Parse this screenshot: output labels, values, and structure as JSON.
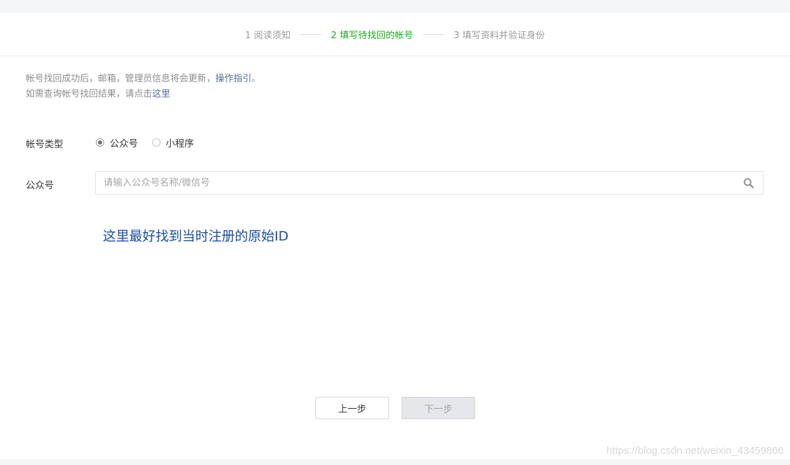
{
  "steps": [
    {
      "label": "1 阅读须知",
      "active": false
    },
    {
      "label": "2 填写待找回的帐号",
      "active": true
    },
    {
      "label": "3 填写资料并验证身份",
      "active": false
    }
  ],
  "notice": {
    "line1_text": "帐号找回成功后，邮箱，管理员信息将会更新，",
    "line1_link": "操作指引",
    "line1_end": "。",
    "line2_text": "如需查询帐号找回结果，请点击",
    "line2_link": "这里"
  },
  "account_type": {
    "label": "帐号类型",
    "options": [
      "公众号",
      "小程序"
    ],
    "selected": "公众号"
  },
  "official_account": {
    "label": "公众号",
    "placeholder": "请输入公众号名称/微信号",
    "value": ""
  },
  "annotation_text": "这里最好找到当时注册的原始ID",
  "buttons": {
    "prev": "上一步",
    "next": "下一步"
  },
  "watermark": "https://blog.csdn.net/weixin_43459866",
  "colors": {
    "active_step": "#1aad19",
    "link": "#576b95",
    "annotation": "#1a4ea0"
  },
  "icons": {
    "search": "search-icon"
  }
}
